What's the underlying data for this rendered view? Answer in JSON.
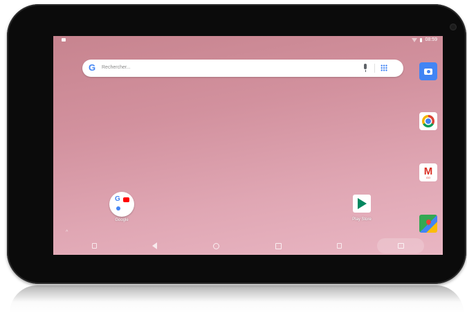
{
  "status_bar": {
    "time": "08:59",
    "icons": [
      "notification-icon",
      "wifi-icon",
      "battery-icon"
    ]
  },
  "search": {
    "logo": "G",
    "placeholder": "Rechercher...",
    "icons": [
      "google-logo-icon",
      "mic-icon",
      "apps-grid-icon"
    ]
  },
  "dock": {
    "apps": [
      {
        "name": "Camera",
        "icon": "camera-icon",
        "color": "#4285f4"
      },
      {
        "name": "Chrome",
        "icon": "chrome-icon"
      },
      {
        "name": "Gmail",
        "icon": "gmail-icon",
        "glyph": "M",
        "badge": "GO"
      },
      {
        "name": "Maps",
        "icon": "maps-icon"
      }
    ]
  },
  "home": {
    "folder": {
      "label": "Google",
      "icon": "google-folder-icon",
      "g_glyph": "G"
    },
    "playstore": {
      "label": "Play Store",
      "icon": "play-store-icon"
    },
    "drawer_caret": "^"
  },
  "nav_bar": {
    "buttons": [
      "volume-down-icon",
      "back-icon",
      "home-icon",
      "recents-icon",
      "volume-up-icon",
      "screenshot-icon"
    ]
  },
  "colors": {
    "wallpaper_top": "#c7848f",
    "wallpaper_bottom": "#e9b6c3",
    "google_blue": "#4285f4",
    "bezel": "#0b0b0b"
  }
}
